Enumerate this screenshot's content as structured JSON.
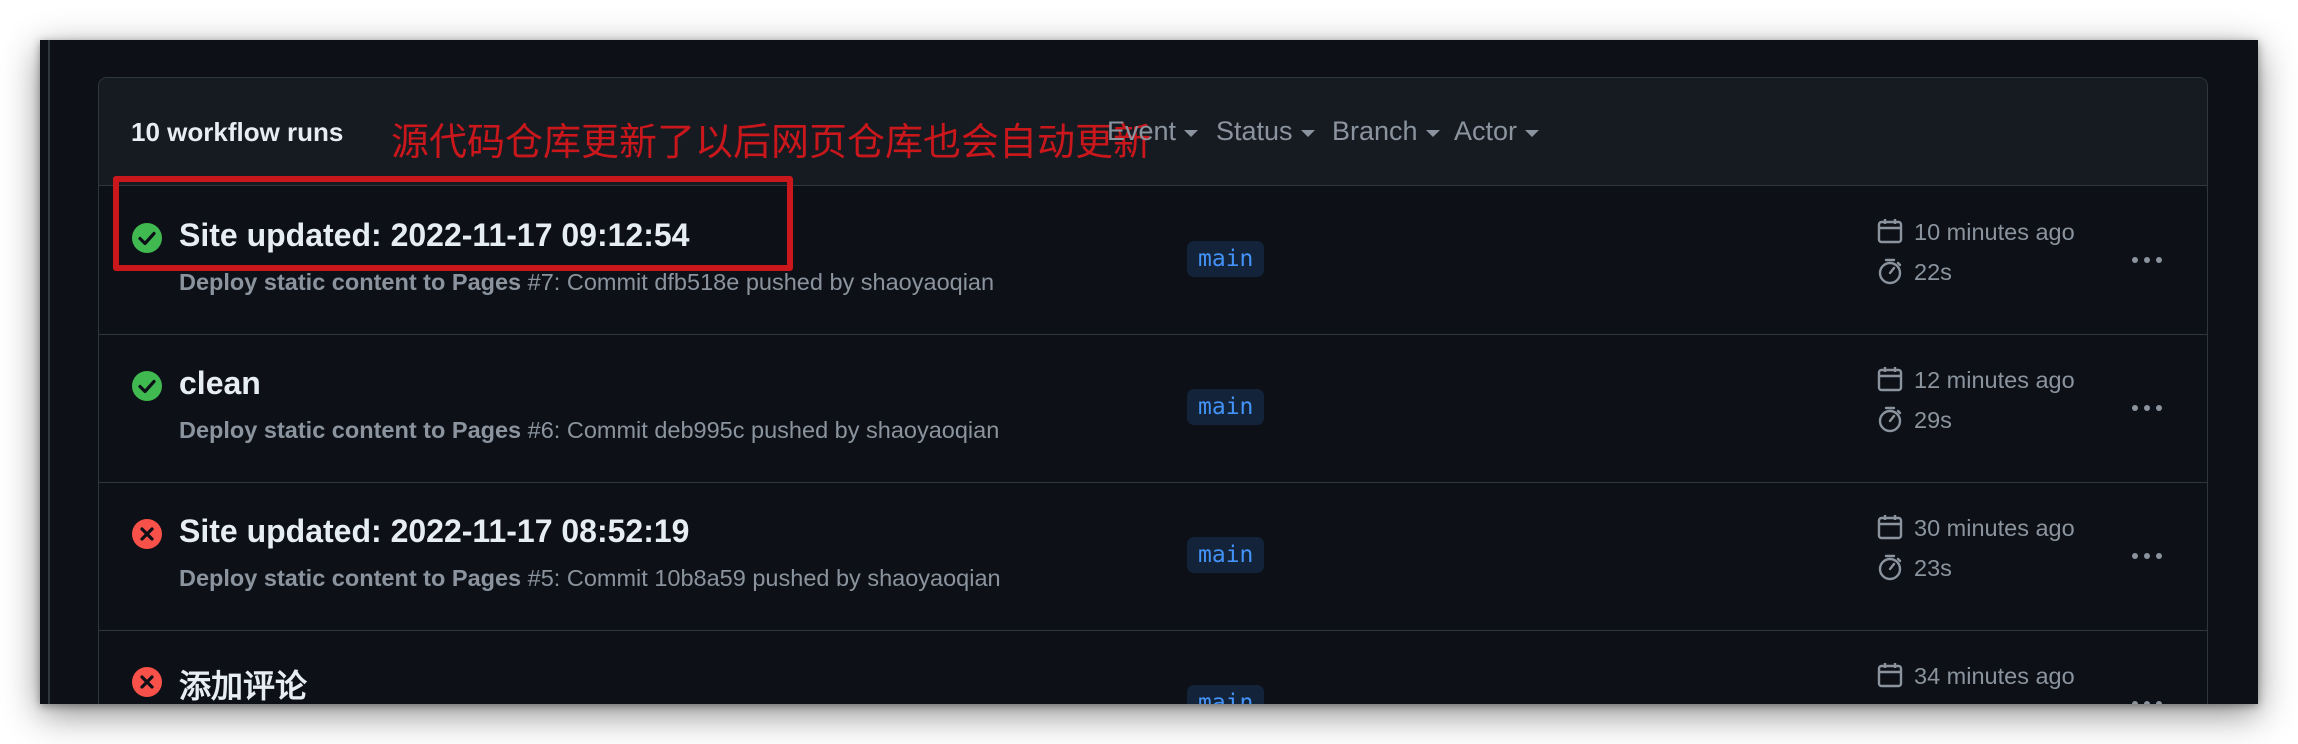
{
  "header": {
    "runs_count": "10 workflow runs",
    "annotation": "源代码仓库更新了以后网页仓库也会自动更新",
    "filters": [
      {
        "label": "Event"
      },
      {
        "label": "Status"
      },
      {
        "label": "Branch"
      },
      {
        "label": "Actor"
      }
    ]
  },
  "runs": [
    {
      "status": "success",
      "title": "Site updated: 2022-11-17 09:12:54",
      "workflow": "Deploy static content to Pages",
      "detail": " #7: Commit dfb518e pushed by shaoyaoqian",
      "branch": "main",
      "time_ago": "10 minutes ago",
      "duration": "22s"
    },
    {
      "status": "success",
      "title": "clean",
      "workflow": "Deploy static content to Pages",
      "detail": " #6: Commit deb995c pushed by shaoyaoqian",
      "branch": "main",
      "time_ago": "12 minutes ago",
      "duration": "29s"
    },
    {
      "status": "failure",
      "title": "Site updated: 2022-11-17 08:52:19",
      "workflow": "Deploy static content to Pages",
      "detail": " #5: Commit 10b8a59 pushed by shaoyaoqian",
      "branch": "main",
      "time_ago": "30 minutes ago",
      "duration": "23s"
    },
    {
      "status": "failure",
      "title": "添加评论",
      "workflow": "",
      "detail": "",
      "branch": "main",
      "time_ago": "34 minutes ago",
      "duration": ""
    }
  ],
  "colors": {
    "background": "#0d1117",
    "header_bg": "#161b22",
    "border": "#30363d",
    "success": "#3fb950",
    "failure": "#f85149",
    "branch_text": "#4493f8",
    "annotation": "#c9171c"
  },
  "icons": {
    "success": "check-circle-fill-icon",
    "failure": "x-circle-fill-icon",
    "created": "calendar-icon",
    "duration": "stopwatch-icon",
    "more": "kebab-horizontal-icon",
    "filter": "triangle-down-icon"
  }
}
